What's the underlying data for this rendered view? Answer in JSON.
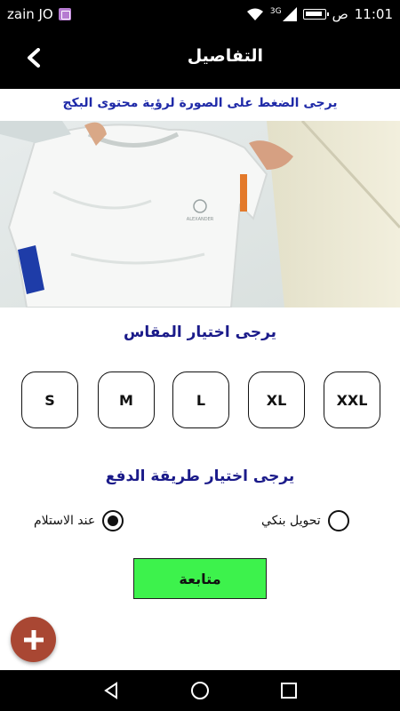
{
  "status_bar": {
    "carrier": "zain JO",
    "network_type": "3G",
    "am_pm": "ص",
    "time": "11:01"
  },
  "header": {
    "title": "التفاصيل",
    "back_icon": "chevron-left-icon"
  },
  "image_hint": "يرجى الضغط على الصورة لرؤية محتوى البكج",
  "product_image": {
    "shirt_logo_text": "ALEXANDER",
    "accent_color": "#1e3ca8"
  },
  "size": {
    "title": "يرجى اختيار المقاس",
    "options": [
      "XXL",
      "XL",
      "L",
      "M",
      "S"
    ]
  },
  "payment": {
    "title": "يرجى اختيار طريقة الدفع",
    "options": [
      {
        "label": "تحويل بنكي",
        "selected": false
      },
      {
        "label": "عند الاستلام",
        "selected": true
      }
    ]
  },
  "continue_label": "متابعة",
  "colors": {
    "header_bg": "#000000",
    "title_blue": "#1b1b8a",
    "continue_green": "#3df24c",
    "fab_red": "#a94733"
  }
}
